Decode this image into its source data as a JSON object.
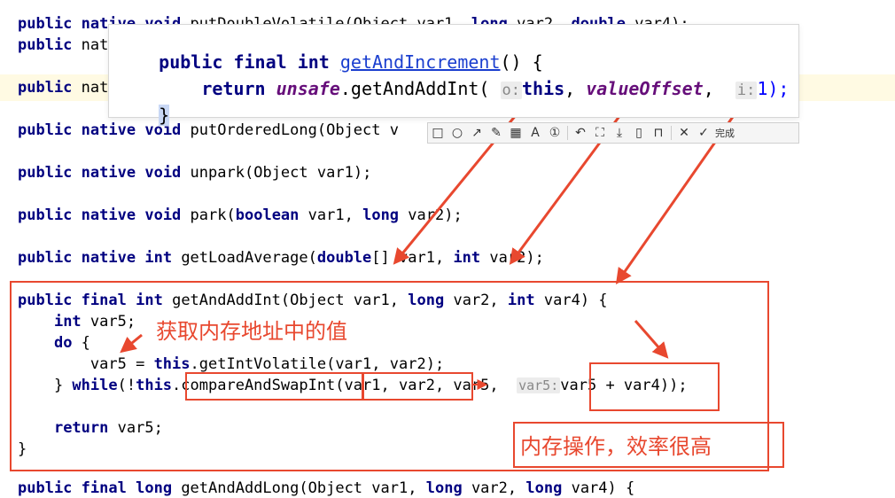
{
  "code_lines": {
    "l0": "public native void putDoubleVolatile(Object var1, long var2, double var4);",
    "l1_prefix": "public nat",
    "l2_prefix": "public nat",
    "l3": "public native void putOrderedLong(Object v",
    "l4": "public native void unpark(Object var1);",
    "l5": "public native void park(boolean var1, long var2);",
    "l6": "public native int getLoadAverage(double[] var1, int var2);",
    "l7": "public final int getAndAddInt(Object var1, long var2, int var4) {",
    "l8": "    int var5;",
    "l9": "    do {",
    "l10": "        var5 = this.getIntVolatile(var1, var2);",
    "l11_a": "    } while(!this.",
    "l11_b": "compareAndSwapInt",
    "l11_c": "(var1, var2",
    "l11_d": ", var5,  ",
    "l11_hint": "var5:",
    "l11_e": "var5 + var4)",
    "l11_f": ");",
    "l13": "    return var5;",
    "l14": "}",
    "l15": "public final long getAndAddLong(Object var1, long var2, long var4) {"
  },
  "popup": {
    "line1_a": "public final int ",
    "line1_method": "getAndIncrement",
    "line1_b": "() {",
    "line2_a": "    return ",
    "line2_unsafe": "unsafe",
    "line2_b": ".getAndAddInt( ",
    "line2_hint_o": "o:",
    "line2_this": "this",
    "line2_c": ", ",
    "line2_offset": "valueOffset",
    "line2_d": ",  ",
    "line2_hint_i": "i:",
    "line2_e": "1);",
    "line3": "}"
  },
  "annotations": {
    "memory_value": "获取内存地址中的值",
    "memory_op": "内存操作，效率很高"
  },
  "toolbar": {
    "icons": [
      "rectangle-icon",
      "circle-icon",
      "arrow-icon",
      "pen-icon",
      "mosaic-icon",
      "text-icon",
      "number-icon",
      "undo-icon",
      "crop-icon",
      "download-icon",
      "pin-icon",
      "bookmark-icon",
      "close-icon",
      "check-icon"
    ],
    "done_label": "完成"
  },
  "colors": {
    "annotation": "#e8482f",
    "keyword": "#000080",
    "line_highlight": "#fffae3"
  }
}
